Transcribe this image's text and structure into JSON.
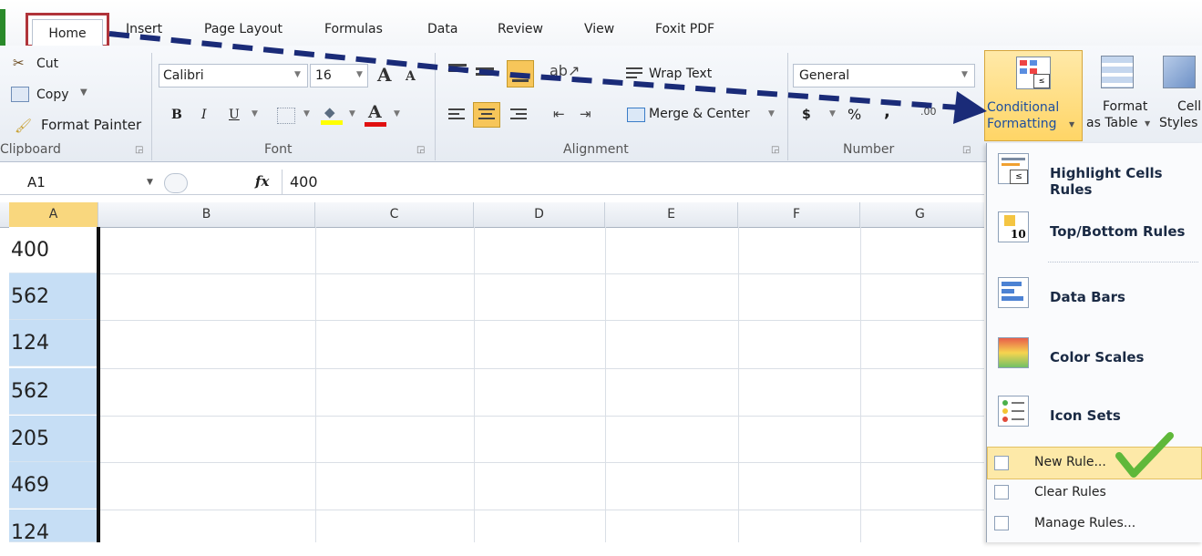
{
  "tabs": {
    "home": "Home",
    "insert": "Insert",
    "page_layout": "Page Layout",
    "formulas": "Formulas",
    "data": "Data",
    "review": "Review",
    "view": "View",
    "foxit": "Foxit PDF"
  },
  "clipboard": {
    "cut": "Cut",
    "copy": "Copy",
    "format_painter": "Format Painter",
    "group": "Clipboard"
  },
  "font": {
    "name": "Calibri",
    "size": "16",
    "group": "Font",
    "bold": "B",
    "italic": "I",
    "underline": "U"
  },
  "alignment": {
    "wrap_text": "Wrap Text",
    "merge_center": "Merge & Center",
    "group": "Alignment"
  },
  "number": {
    "format": "General",
    "currency": "$",
    "percent": "%",
    "comma": ",",
    "group": "Number"
  },
  "styles": {
    "conditional_1": "Conditional",
    "conditional_2": "Formatting",
    "format_1": "Format",
    "format_2": "as Table",
    "cell_1": "Cell",
    "cell_2": "Styles"
  },
  "formula_bar": {
    "name_box": "A1",
    "fx": "fx",
    "value": "400"
  },
  "columns": [
    "A",
    "B",
    "C",
    "D",
    "E",
    "F",
    "G"
  ],
  "cells_a": [
    "400",
    "562",
    "124",
    "562",
    "205",
    "469",
    "124"
  ],
  "menu": {
    "highlight": "Highlight Cells Rules",
    "topbottom": "Top/Bottom Rules",
    "databars": "Data Bars",
    "colorscales": "Color Scales",
    "iconsets": "Icon Sets",
    "newrule": "New Rule...",
    "clearrules": "Clear Rules",
    "managerules": "Manage Rules...",
    "topbottom_badge": "10"
  },
  "colors": {
    "highlight_box": "#b0343a",
    "arrow": "#1a2b78",
    "selected_cells": "#c6def5",
    "menu_hover": "#fde9a8",
    "check": "#5fb83a"
  }
}
